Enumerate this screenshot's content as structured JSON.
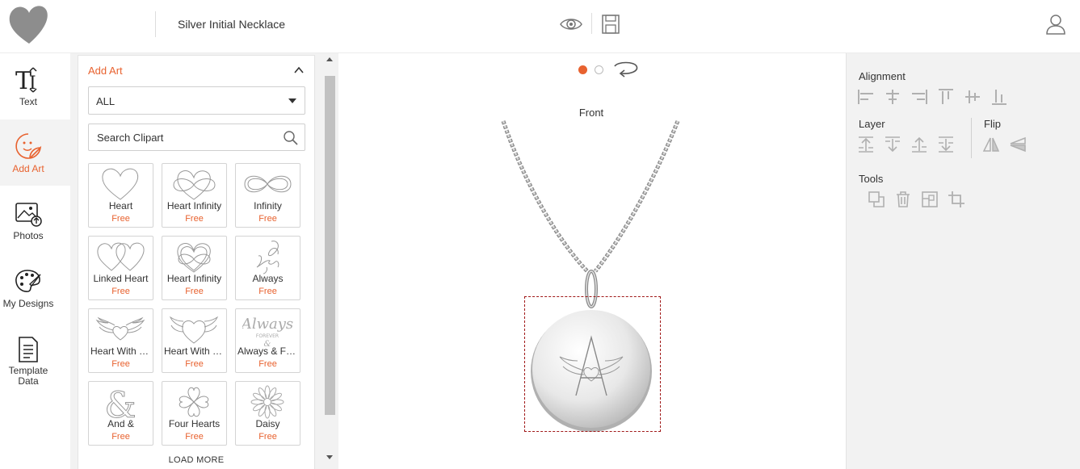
{
  "header": {
    "product_title": "Silver Initial Necklace",
    "icons": [
      "heart-logo-icon",
      "eye-icon",
      "save-icon",
      "user-icon"
    ]
  },
  "rail": {
    "items": [
      {
        "label": "Text",
        "icon": "text-icon",
        "active": false
      },
      {
        "label": "Add Art",
        "icon": "sticker-icon",
        "active": true
      },
      {
        "label": "Photos",
        "icon": "photo-upload-icon",
        "active": false
      },
      {
        "label": "My Designs",
        "icon": "palette-icon",
        "active": false
      },
      {
        "label": "Template Data",
        "icon": "document-icon",
        "active": false
      }
    ]
  },
  "art_panel": {
    "title": "Add Art",
    "category_selected": "ALL",
    "search_placeholder": "Search Clipart",
    "items": [
      {
        "name": "Heart",
        "price": "Free",
        "icon": "heart-art-icon"
      },
      {
        "name": "Heart Infinity",
        "price": "Free",
        "icon": "heart-infinity-art-icon"
      },
      {
        "name": "Infinity",
        "price": "Free",
        "icon": "infinity-art-icon"
      },
      {
        "name": "Linked Heart",
        "price": "Free",
        "icon": "linked-hearts-art-icon"
      },
      {
        "name": "Heart Infinity",
        "price": "Free",
        "icon": "heart-infinity-knot-art-icon"
      },
      {
        "name": "Always",
        "price": "Free",
        "icon": "always-script-art-icon"
      },
      {
        "name": "Heart With Wings",
        "price": "Free",
        "icon": "heart-wings-art-icon"
      },
      {
        "name": "Heart With Wings",
        "price": "Free",
        "icon": "heart-wings-2-art-icon"
      },
      {
        "name": "Always & Forever",
        "price": "Free",
        "icon": "always-forever-art-icon"
      },
      {
        "name": "And &",
        "price": "Free",
        "icon": "ampersand-art-icon"
      },
      {
        "name": "Four Hearts",
        "price": "Free",
        "icon": "four-hearts-art-icon"
      },
      {
        "name": "Daisy",
        "price": "Free",
        "icon": "daisy-art-icon"
      }
    ],
    "load_more": "LOAD MORE"
  },
  "canvas": {
    "side_label": "Front",
    "pages": 2,
    "active_page": 1,
    "engraving_letter": "A"
  },
  "right_panel": {
    "alignment_label": "Alignment",
    "layer_label": "Layer",
    "flip_label": "Flip",
    "tools_label": "Tools"
  },
  "colors": {
    "accent": "#e8622f",
    "selection": "#a01818",
    "panel_bg": "#f2f2f2"
  }
}
